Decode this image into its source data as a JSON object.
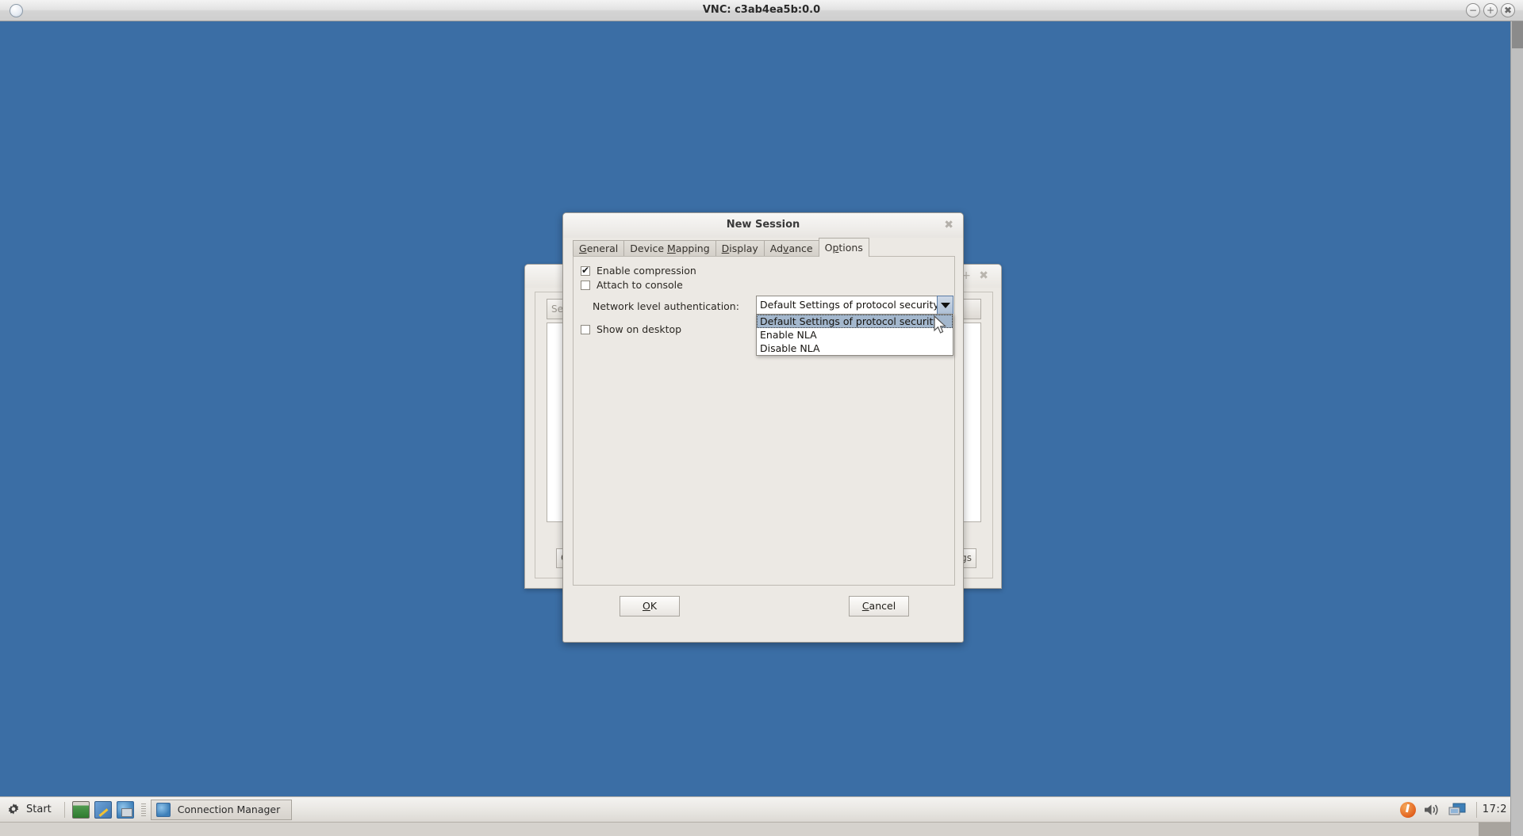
{
  "vnc_window": {
    "title": "VNC: c3ab4ea5b:0.0",
    "app_icon": "vnc-icon",
    "controls": {
      "minimize": "−",
      "maximize": "+",
      "close": "✖"
    }
  },
  "desktop": {
    "background_color": "#3b6ea5"
  },
  "background_window": {
    "title": "",
    "controls": {
      "add": "+",
      "close": "✖"
    },
    "search_button_label": "Se",
    "left_button_label": "C",
    "right_button_label": "gs"
  },
  "dialog": {
    "title": "New Session",
    "close_label": "✖",
    "tabs": [
      {
        "label": "General",
        "accel": "G",
        "active": false
      },
      {
        "label": "Device Mapping",
        "accel": "M",
        "active": false
      },
      {
        "label": "Display",
        "accel": "D",
        "active": false
      },
      {
        "label": "Advance",
        "accel": "v",
        "active": false
      },
      {
        "label": "Options",
        "accel": "p",
        "active": true
      }
    ],
    "options_tab": {
      "checkboxes": [
        {
          "label": "Enable compression",
          "checked": true
        },
        {
          "label": "Attach to console",
          "checked": false
        },
        {
          "label": "Show on desktop",
          "checked": false
        }
      ],
      "network_level_authentication": {
        "label": "Network level authentication:",
        "value": "Default Settings of protocol security",
        "expanded": true,
        "options": [
          "Default Settings of protocol security",
          "Enable NLA",
          "Disable NLA"
        ],
        "selected_index": 0,
        "highlight_color": "#a3b7cd"
      }
    },
    "buttons": {
      "ok": "OK",
      "ok_accel": "O",
      "cancel": "Cancel",
      "cancel_accel": "C"
    }
  },
  "taskbar": {
    "start_label": "Start",
    "start_icon": "gear-icon",
    "launchers": [
      {
        "name": "terminal-icon"
      },
      {
        "name": "settings-icon"
      },
      {
        "name": "remote-desktop-icon"
      }
    ],
    "task_buttons": [
      {
        "label": "Connection Manager",
        "icon": "remote-desktop-icon",
        "active": true
      }
    ],
    "tray": {
      "update_icon": "update-notifier-icon",
      "volume_icon": "volume-icon",
      "display_icon": "display-icon",
      "clock": "17:2"
    }
  }
}
